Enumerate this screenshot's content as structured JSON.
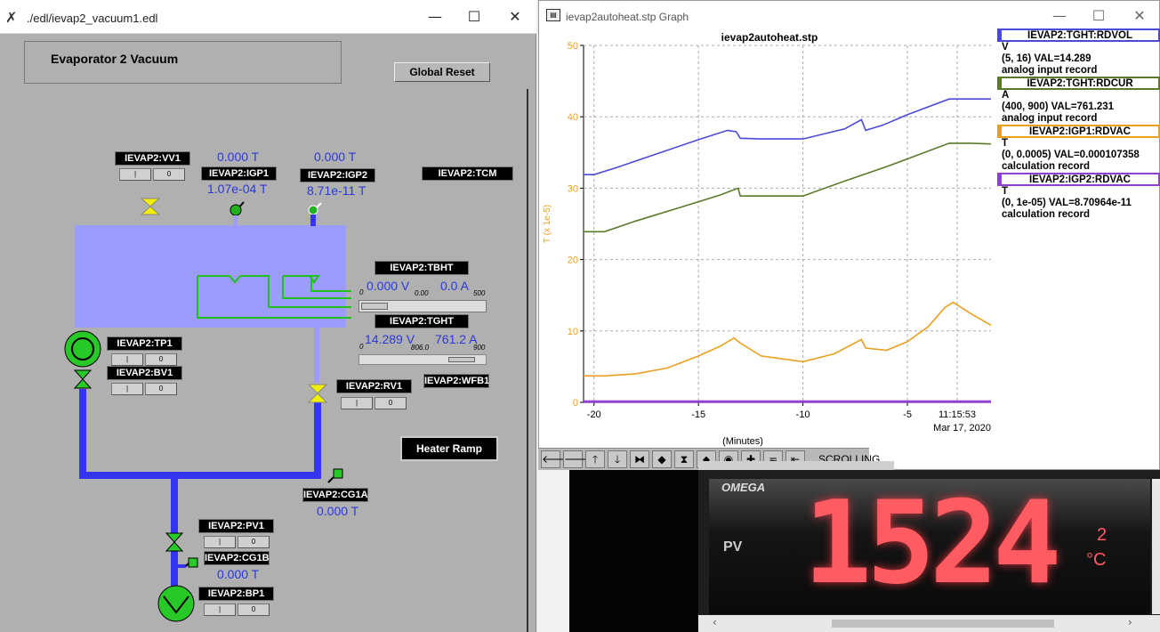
{
  "edl": {
    "title": "./edl/ievap2_vacuum1.edl",
    "panel_title": "Evaporator 2 Vacuum",
    "global_reset": "Global Reset",
    "heater_ramp": "Heater Ramp",
    "labels": {
      "vv1": "IEVAP2:VV1",
      "igp1": "IEVAP2:IGP1",
      "igp2": "IEVAP2:IGP2",
      "tcm": "IEVAP2:TCM",
      "tbht": "IEVAP2:TBHT",
      "tght": "IEVAP2:TGHT",
      "tp1": "IEVAP2:TP1",
      "bv1": "IEVAP2:BV1",
      "rv1": "IEVAP2:RV1",
      "wfb1": "IEVAP2:WFB1",
      "cg1a": "IEVAP2:CG1A",
      "pv1": "IEVAP2:PV1",
      "cg1b": "IEVAP2:CG1B",
      "bp1": "IEVAP2:BP1"
    },
    "values": {
      "igp1_top": "0.000 T",
      "igp1_reading": "1.07e-04 T",
      "igp2_top": "0.000 T",
      "igp2_reading": "8.71e-11 T",
      "tbht_v": "0.000 V",
      "tbht_a": "0.0 A",
      "tbht_a_small": "0.00",
      "tbht_min": "0",
      "tbht_max": "500",
      "tght_v": "14.289 V",
      "tght_a": "761.2 A",
      "tght_a_small": "806.0",
      "tght_min": "0",
      "tght_max": "900",
      "cg1a": "0.000 T",
      "cg1b": "0.000 T"
    },
    "button_labels": {
      "off": "|",
      "on": "0"
    },
    "colors": {
      "background": "#b0b0b0",
      "chamber": "#9c9cff",
      "pipe": "#3535f0",
      "valve": "#f0f000",
      "pump": "#28c828"
    }
  },
  "graph": {
    "window_title": "ievap2autoheat.stp Graph",
    "status": "SCROLLING",
    "legend": [
      {
        "name": "IEVAP2:TGHT:RDVOL",
        "unit": "V",
        "range": "(5, 16) VAL=14.289",
        "type": "analog input record",
        "color": "#4a4ad8"
      },
      {
        "name": "IEVAP2:TGHT:RDCUR",
        "unit": "A",
        "range": "(400, 900) VAL=761.231",
        "type": "analog input record",
        "color": "#5a7a2a"
      },
      {
        "name": "IEVAP2:IGP1:RDVAC",
        "unit": "T",
        "range": "(0, 0.0005) VAL=0.000107358",
        "type": "calculation record",
        "color": "#e8a020"
      },
      {
        "name": "IEVAP2:IGP2:RDVAC",
        "unit": "T",
        "range": "(0, 1e-05) VAL=8.70964e-11",
        "type": "calculation record",
        "color": "#9040d0"
      }
    ]
  },
  "chart_data": {
    "type": "line",
    "title": "ievap2autoheat.stp",
    "xlabel": "(Minutes)",
    "ylabel": "T (x 1e-5)",
    "xlim": [
      -20.5,
      -1
    ],
    "ylim": [
      0,
      50
    ],
    "x_ticks": [
      "-20",
      "-15",
      "-10",
      "-5"
    ],
    "y_ticks": [
      "0",
      "10",
      "20",
      "30",
      "40",
      "50"
    ],
    "time_label": "11:15:53",
    "date_label": "Mar 17, 2020",
    "grid": true,
    "series": [
      {
        "name": "IEVAP2:TGHT:RDVOL",
        "color": "#4a4ad8",
        "x": [
          -20.5,
          -20,
          -19,
          -17,
          -15,
          -13.6,
          -13.2,
          -13,
          -12,
          -10,
          -8,
          -7.2,
          -7,
          -6.2,
          -5,
          -3,
          -2,
          -1
        ],
        "y": [
          31.9,
          31.9,
          32.8,
          34.8,
          36.8,
          38.1,
          37.9,
          37.0,
          36.9,
          36.9,
          38.3,
          39.6,
          38.1,
          38.8,
          40.3,
          42.5,
          42.5,
          42.5
        ]
      },
      {
        "name": "IEVAP2:TGHT:RDCUR",
        "color": "#5a7a2a",
        "x": [
          -20.5,
          -19.5,
          -18,
          -16,
          -14,
          -13.1,
          -13,
          -12,
          -10,
          -8,
          -6,
          -5,
          -3,
          -2,
          -1
        ],
        "y": [
          23.9,
          23.9,
          25.4,
          27.2,
          29.0,
          30.0,
          28.9,
          28.9,
          28.9,
          31.0,
          33.0,
          34.1,
          36.3,
          36.3,
          36.2
        ]
      },
      {
        "name": "IEVAP2:IGP1:RDVAC",
        "color": "#e8a020",
        "x": [
          -20.5,
          -19.5,
          -18,
          -16.5,
          -15,
          -14,
          -13.3,
          -13,
          -12,
          -10,
          -8.5,
          -7.2,
          -7,
          -6,
          -5,
          -4,
          -3.2,
          -2.8,
          -2,
          -1
        ],
        "y": [
          3.7,
          3.7,
          4.0,
          4.8,
          6.5,
          7.8,
          9.0,
          8.3,
          6.5,
          5.7,
          6.8,
          8.8,
          7.6,
          7.3,
          8.5,
          10.6,
          13.3,
          14.0,
          12.5,
          10.8
        ]
      },
      {
        "name": "IEVAP2:IGP2:RDVAC",
        "color": "#9040d0",
        "x": [
          -20.5,
          -1
        ],
        "y": [
          0.1,
          0.1
        ]
      }
    ]
  },
  "video": {
    "brand": "OMEGA",
    "pv_label": "PV",
    "reading": "1524",
    "sub_digit": "2",
    "unit": "°C"
  }
}
